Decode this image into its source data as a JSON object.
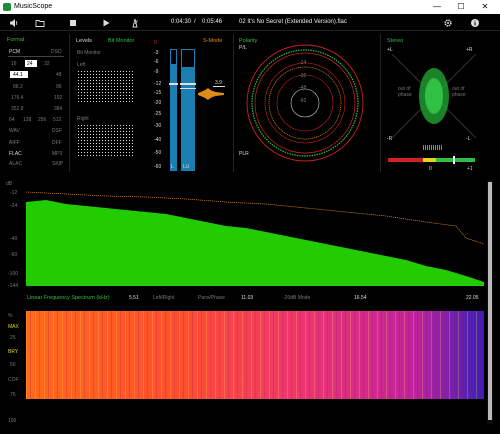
{
  "window": {
    "title": "MusicScope",
    "minimize": "—",
    "maximize": "☐",
    "close": "✕"
  },
  "toolbar": {
    "time_current": "0:04:30",
    "separator": "/",
    "time_total": "0:05:46",
    "track": "02 It's No Secret (Extended Version).flac"
  },
  "format": {
    "title": "Format",
    "pcm": "PCM",
    "dsd": "DSD",
    "bits": [
      "16",
      "24",
      "32"
    ],
    "rates_left": [
      "44.1",
      "88.2",
      "176.4",
      "352.8"
    ],
    "rates_right": [
      "48",
      "96",
      "192",
      "384"
    ],
    "dsd_rates": [
      "64",
      "128",
      "256",
      "512"
    ],
    "formats_left": [
      "WAV",
      "AIFF",
      "FLAC",
      "ALAC"
    ],
    "formats_right": [
      "DSF",
      "DFF",
      "MP3",
      "SKIP"
    ]
  },
  "levels": {
    "title": "Levels",
    "mode": "Bit Monitor",
    "bit_monitor": "Bit Monitor",
    "left": "Left",
    "right": "Right",
    "s_mode": "S-Mode",
    "scale": [
      "0",
      "-3",
      "-6",
      "-9",
      "-12",
      "-15",
      "-20",
      "-25",
      "-30",
      "-40",
      "-50",
      "-60"
    ],
    "peak_value": "3.9",
    "meter_l": "L",
    "meter_r": "R",
    "lu": "LU",
    "level_left_fraction": 0.88,
    "level_right_fraction": 0.86
  },
  "polarity": {
    "title": "Polarity",
    "pl": "P/L",
    "plr": "PLR",
    "scale": [
      "-24",
      "-36",
      "-48",
      "-60"
    ]
  },
  "stereo": {
    "title": "Stereo",
    "plus_l": "+L",
    "plus_r": "+R",
    "minus_l": "-R",
    "minus_r": "-L",
    "out_of_phase_left": "out of\nphase",
    "out_of_phase_right": "out of\nphase",
    "corr_left": "-1",
    "corr_mid": "0",
    "corr_right": "+1"
  },
  "spectrum": {
    "db_label": "dB",
    "y_ticks": [
      "-12",
      "-24",
      "-40",
      "-60",
      "-100",
      "-144"
    ],
    "mode_label": "Linear Frequency Spectrum (kHz)",
    "options": [
      "Left/Right",
      "Pans/Phase",
      "-20dB Mode"
    ],
    "x_ticks": [
      "5.51",
      "11.03",
      "16.54",
      "22.05"
    ]
  },
  "spectrogram": {
    "pct_label": "%",
    "labels": [
      "MAX",
      "25",
      "BRY",
      "50",
      "COF",
      "75",
      "100"
    ]
  },
  "colors": {
    "accent": "#2fbf45",
    "level_bar": "#1a7fb0",
    "peak": "#e08a18",
    "red": "#cc2222",
    "spectrum": "#22cc00"
  }
}
